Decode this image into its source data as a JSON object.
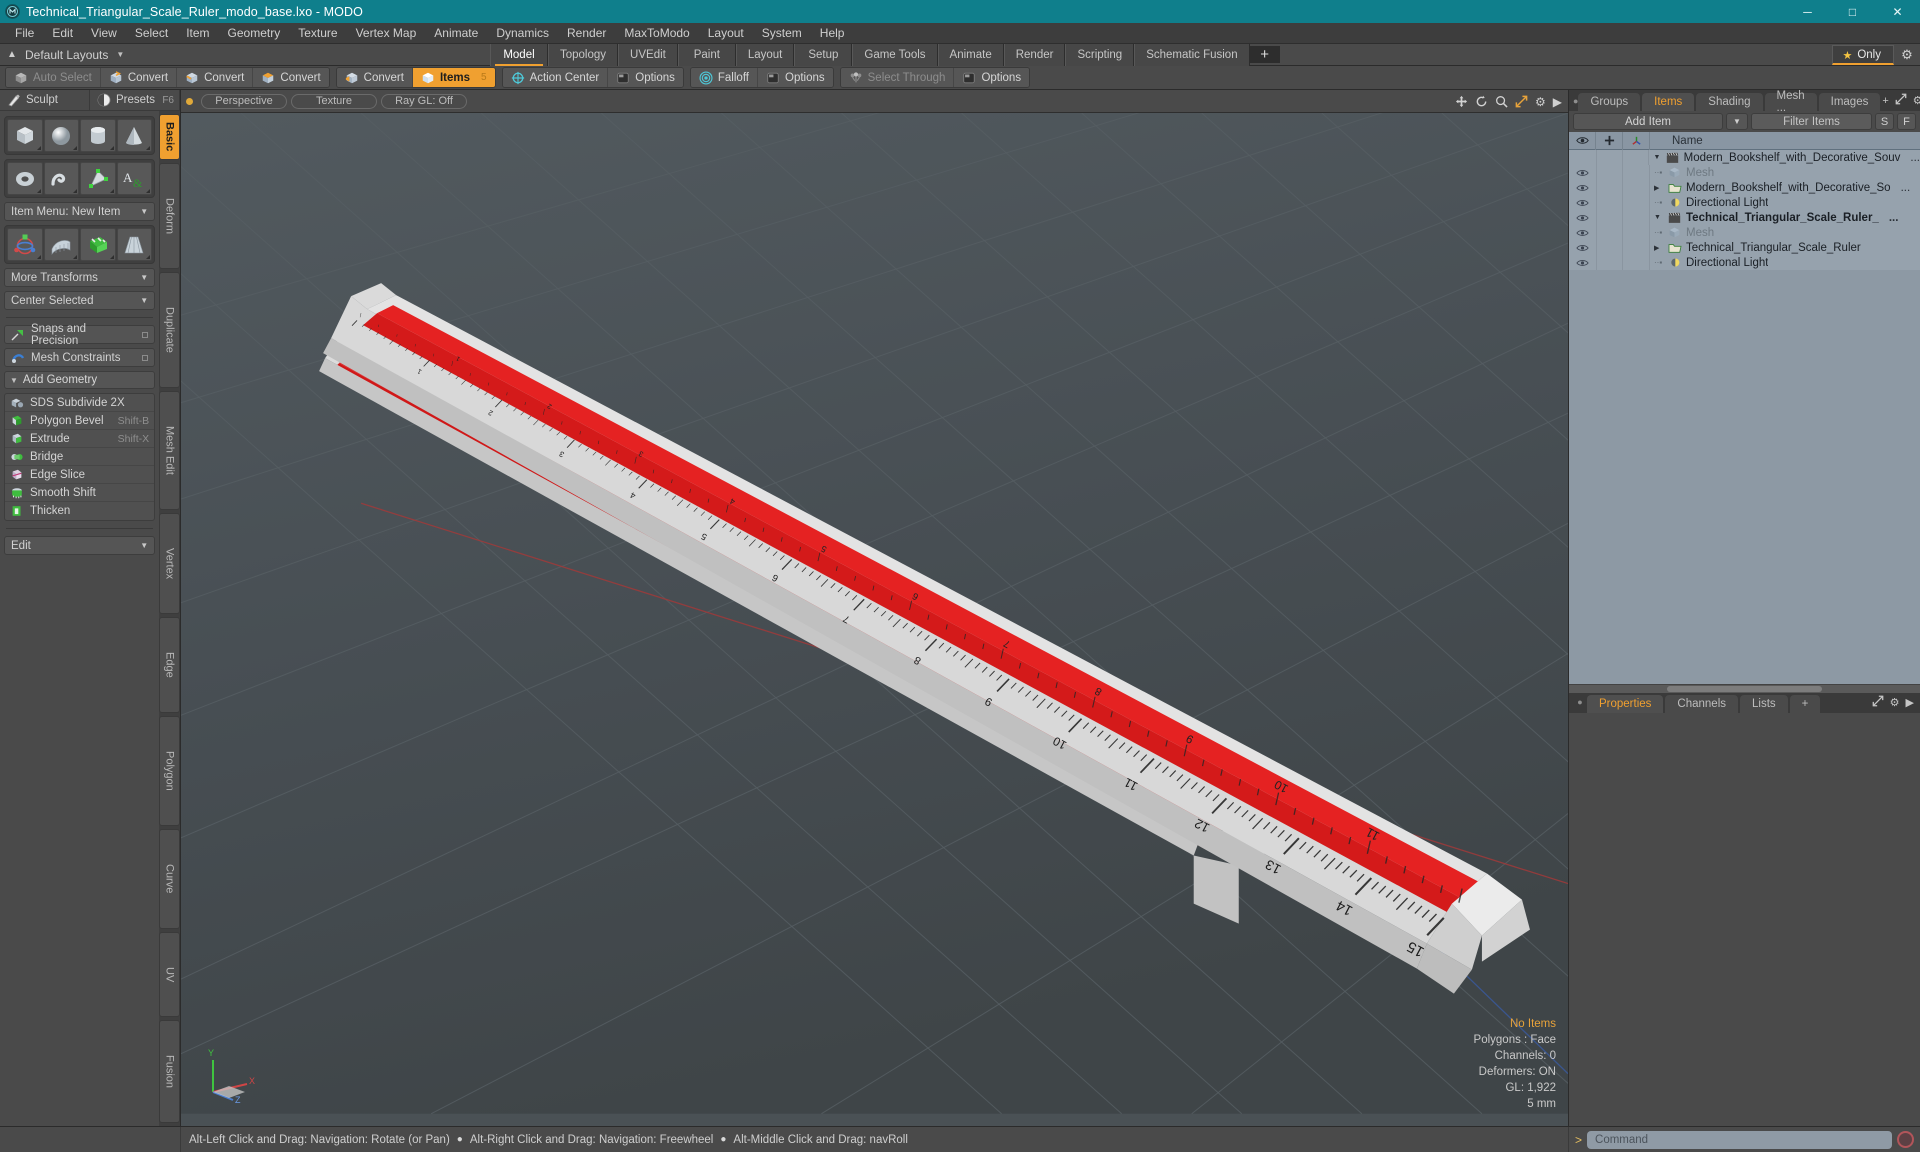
{
  "window": {
    "title": "Technical_Triangular_Scale_Ruler_modo_base.lxo - MODO",
    "app_icon": "modo-logo-icon",
    "minimize": "─",
    "maximize": "□",
    "close": "✕"
  },
  "menubar": {
    "items": [
      "File",
      "Edit",
      "View",
      "Select",
      "Item",
      "Geometry",
      "Texture",
      "Vertex Map",
      "Animate",
      "Dynamics",
      "Render",
      "MaxToModo",
      "Layout",
      "System",
      "Help"
    ]
  },
  "layoutbar": {
    "default_layouts": "Default Layouts",
    "caret": "▼",
    "up_arrow": "▲",
    "tabs": [
      "Model",
      "Topology",
      "UVEdit",
      "Paint",
      "Layout",
      "Setup",
      "Game Tools",
      "Animate",
      "Render",
      "Scripting",
      "Schematic Fusion"
    ],
    "active_tab": "Model",
    "plus": "+",
    "only_label": "Only",
    "star_icon": "star-icon",
    "gear_icon": "gear-icon"
  },
  "toolbar": {
    "groups": [
      {
        "buttons": [
          {
            "label": "Auto Select",
            "icon": "cube-grey-icon",
            "state": "dim"
          },
          {
            "label": "Convert",
            "icon": "cube-vertex-icon",
            "state": "normal"
          },
          {
            "label": "Convert",
            "icon": "cube-edge-icon",
            "state": "normal"
          },
          {
            "label": "Convert",
            "icon": "cube-polygon-icon",
            "state": "normal"
          }
        ]
      },
      {
        "buttons": [
          {
            "label": "Convert",
            "icon": "cube-item-icon",
            "state": "normal"
          },
          {
            "label": "Items",
            "icon": "cube-orange-icon",
            "state": "active",
            "kbd": "5"
          }
        ]
      },
      {
        "buttons": [
          {
            "label": "Action Center",
            "icon": "crosshair-icon",
            "state": "normal"
          },
          {
            "label": "Options",
            "icon": "panel-icon",
            "state": "normal"
          }
        ]
      },
      {
        "buttons": [
          {
            "label": "Falloff",
            "icon": "falloff-icon",
            "state": "normal"
          },
          {
            "label": "Options",
            "icon": "panel-icon",
            "state": "normal"
          }
        ]
      },
      {
        "buttons": [
          {
            "label": "Select Through",
            "icon": "select-through-icon",
            "state": "dim"
          },
          {
            "label": "Options",
            "icon": "panel-icon",
            "state": "normal"
          }
        ]
      }
    ]
  },
  "left_panel": {
    "top_tabs": [
      {
        "label": "Sculpt",
        "icon": "sculpt-icon"
      },
      {
        "label": "Presets",
        "icon": "presets-sphere-icon",
        "shortcut": "F6"
      }
    ],
    "primitive_row_1": [
      "cube-icon",
      "sphere-icon",
      "cylinder-icon",
      "cone-icon"
    ],
    "primitive_row_2": [
      "torus-icon",
      "spiral-icon",
      "polygon-tool-icon",
      "text-tool-icon"
    ],
    "item_menu": "Item Menu: New Item",
    "transform_row": [
      "transform-gizmo-icon",
      "bend-grid-icon",
      "deform-green-icon",
      "taper-icon"
    ],
    "more_transforms": "More Transforms",
    "center_selected": "Center Selected",
    "snaps_and_precision": "Snaps and Precision",
    "mesh_constraints": "Mesh Constraints",
    "add_geometry_header": "Add Geometry",
    "geometry_items": [
      {
        "label": "SDS Subdivide 2X",
        "shortcut": "",
        "icon": "sds-subdivide-icon"
      },
      {
        "label": "Polygon Bevel",
        "shortcut": "Shift-B",
        "icon": "bevel-icon"
      },
      {
        "label": "Extrude",
        "shortcut": "Shift-X",
        "icon": "extrude-icon"
      },
      {
        "label": "Bridge",
        "shortcut": "",
        "icon": "bridge-icon"
      },
      {
        "label": "Edge Slice",
        "shortcut": "",
        "icon": "edge-slice-icon"
      },
      {
        "label": "Smooth Shift",
        "shortcut": "",
        "icon": "smooth-shift-icon"
      },
      {
        "label": "Thicken",
        "shortcut": "",
        "icon": "thicken-icon"
      }
    ],
    "edit_dropdown": "Edit",
    "vertical_tabs": [
      "Basic",
      "Deform",
      "Duplicate",
      "Mesh Edit",
      "Vertex",
      "Edge",
      "Polygon",
      "Curve",
      "UV",
      "Fusion"
    ],
    "vertical_active": "Basic"
  },
  "viewport": {
    "header": {
      "view_mode": "Perspective",
      "shading": "Texture",
      "raygl": "Ray GL: Off",
      "icons": [
        "move-icon",
        "rotate-icon",
        "zoom-icon",
        "fit-icon",
        "gear-icon",
        "chevron-right-icon"
      ]
    },
    "stats": {
      "selection": "No Items",
      "polygons": "Polygons : Face",
      "channels": "Channels: 0",
      "deformers": "Deformers: ON",
      "gl": "GL: 1,922",
      "grid_size": "5 mm"
    },
    "axis": {
      "y": "Y",
      "x": "X",
      "z": "Z"
    },
    "background_color": "#4a5155",
    "object_color": "#d6d6d6",
    "accent_stripe_color": "#e02020"
  },
  "right_panel": {
    "tabs": [
      "Groups",
      "Items",
      "Shading",
      "Mesh ...",
      "Images"
    ],
    "active_tab": "Items",
    "plus": "+",
    "tools": [
      "expand-icon",
      "gear-icon",
      "chevron-right-icon"
    ],
    "add_item": "Add Item",
    "add_item_caret": "▼",
    "filter_placeholder": "Filter Items",
    "s_button": "S",
    "f_button": "F",
    "columns": [
      "eye-icon",
      "add-icon",
      "axis-icon",
      "Name"
    ],
    "rows": [
      {
        "name": "Modern_Bookshelf_with_Decorative_Souv",
        "suffix": "...",
        "icon": "scene-clapper-icon",
        "indent": 0,
        "expander": "▼",
        "eye": false,
        "bold": false,
        "dim": false
      },
      {
        "name": "Mesh",
        "suffix": "",
        "icon": "mesh-cube-icon",
        "indent": 1,
        "expander": "",
        "eye": true,
        "bold": false,
        "dim": true
      },
      {
        "name": "Modern_Bookshelf_with_Decorative_So",
        "suffix": "...",
        "icon": "folder-icon",
        "indent": 1,
        "expander": "▶",
        "eye": true,
        "bold": false,
        "dim": false
      },
      {
        "name": "Directional Light",
        "suffix": "",
        "icon": "light-icon",
        "indent": 1,
        "expander": "",
        "eye": true,
        "bold": false,
        "dim": false
      },
      {
        "name": "Technical_Triangular_Scale_Ruler_",
        "suffix": "...",
        "icon": "scene-clapper-icon",
        "indent": 0,
        "expander": "▼",
        "eye": true,
        "bold": true,
        "dim": false
      },
      {
        "name": "Mesh",
        "suffix": "",
        "icon": "mesh-cube-icon",
        "indent": 1,
        "expander": "",
        "eye": true,
        "bold": false,
        "dim": true
      },
      {
        "name": "Technical_Triangular_Scale_Ruler",
        "suffix": "",
        "icon": "folder-icon",
        "indent": 1,
        "expander": "▶",
        "eye": true,
        "bold": false,
        "dim": false
      },
      {
        "name": "Directional Light",
        "suffix": "",
        "icon": "light-icon",
        "indent": 1,
        "expander": "",
        "eye": true,
        "bold": false,
        "dim": false
      }
    ],
    "bottom_tabs": [
      "Properties",
      "Channels",
      "Lists"
    ],
    "bottom_active": "Properties",
    "bottom_plus": "+"
  },
  "statusbar": {
    "hints": [
      "Alt-Left Click and Drag: Navigation: Rotate (or Pan)",
      "Alt-Right Click and Drag: Navigation: Freewheel",
      "Alt-Middle Click and Drag: navRoll"
    ],
    "bullet": "●",
    "command_prompt": ">",
    "command_placeholder": "Command",
    "record_icon": "record-icon"
  }
}
